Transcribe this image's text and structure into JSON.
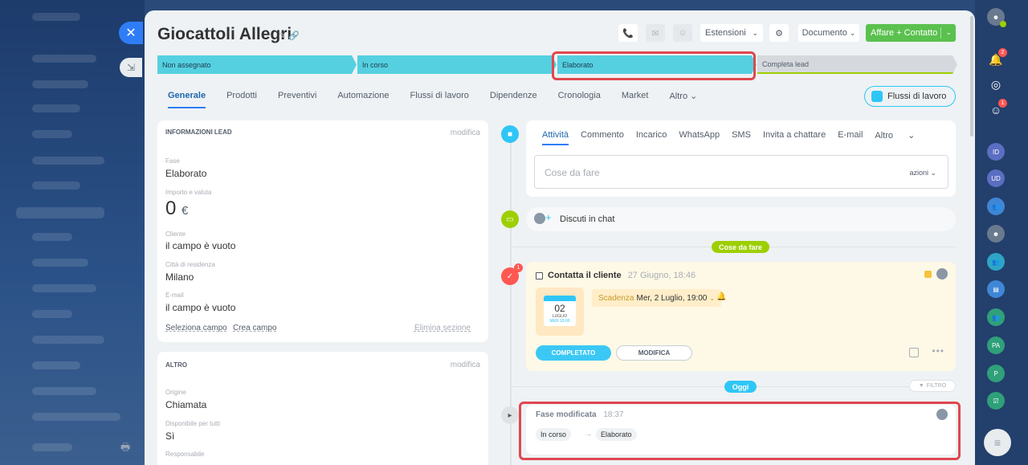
{
  "header": {
    "title": "Giocattoli Allegri",
    "estensioni": "Estensioni",
    "documento": "Documento",
    "affare": "Affare + Contatto"
  },
  "stages": [
    {
      "label": "Non assegnato"
    },
    {
      "label": "In corso"
    },
    {
      "label": "Elaborato"
    },
    {
      "label": "Completa lead"
    }
  ],
  "tabs": [
    "Generale",
    "Prodotti",
    "Preventivi",
    "Automazione",
    "Flussi di lavoro",
    "Dipendenze",
    "Cronologia",
    "Market",
    "Altro"
  ],
  "flussi_button": "Flussi di lavoro",
  "lead_info": {
    "title": "INFORMAZIONI LEAD",
    "edit": "modifica",
    "fase_label": "Fase",
    "fase_value": "Elaborato",
    "importo_label": "Importo e valuta",
    "importo_value": "0",
    "currency": "€",
    "cliente_label": "Cliente",
    "cliente_value": "il campo è vuoto",
    "citta_label": "Città di residenza",
    "citta_value": "Milano",
    "email_label": "E-mail",
    "email_value": "il campo è vuoto",
    "seleziona": "Seleziona campo",
    "crea": "Crea campo",
    "elimina": "Elimina sezione"
  },
  "altro": {
    "title": "ALTRO",
    "edit": "modifica",
    "origine_label": "Origine",
    "origine_value": "Chiamata",
    "disponibile_label": "Disponibile per tutti",
    "disponibile_value": "Sì",
    "responsabile_label": "Responsabile"
  },
  "activity": {
    "tabs": [
      "Attività",
      "Commento",
      "Incarico",
      "WhatsApp",
      "SMS",
      "Invita a chattare",
      "E-mail",
      "Altro"
    ],
    "placeholder": "Cose da fare",
    "azioni": "azioni"
  },
  "chat": {
    "label": "Discuti in chat"
  },
  "pills": {
    "cose_da_fare": "Cose da fare",
    "oggi": "Oggi",
    "filtro": "FILTRO"
  },
  "task": {
    "title": "Contatta il cliente",
    "time": "27 Giugno, 18:46",
    "cal_day": "02",
    "cal_month": "LUGLIO",
    "cal_dow": "MER 19:00",
    "scadenza_label": "Scadenza",
    "scadenza_value": "Mer, 2 Luglio, 19:00",
    "done": "COMPLETATO",
    "edit": "MODIFICA",
    "badge": "1"
  },
  "fase_changed": {
    "title": "Fase modificata",
    "time": "18:37",
    "from": "In corso",
    "to": "Elaborato"
  },
  "right_bar": {
    "badge_bell": "2",
    "badge_chat": "1",
    "avatars": [
      "ID",
      "UD",
      "PA",
      "P"
    ]
  },
  "colors": {
    "accent": "#2f7df6",
    "stage_active": "#55d0e0",
    "highlight": "#e0474f",
    "green": "#5ac14e"
  }
}
